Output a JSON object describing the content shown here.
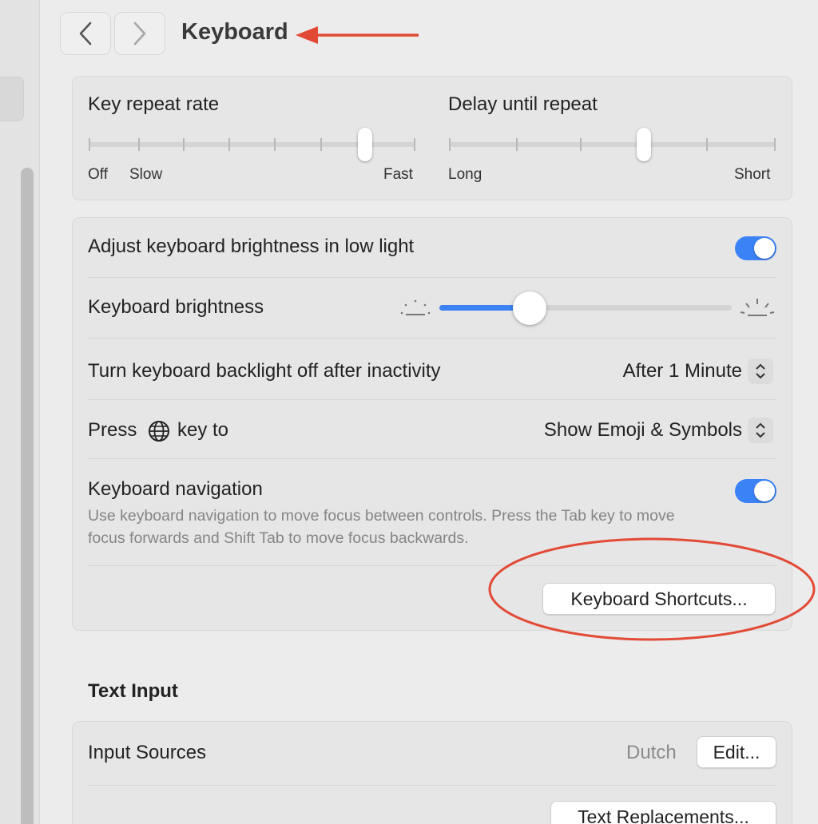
{
  "window": {
    "title": "Keyboard",
    "back_icon": "chevron-left-icon",
    "forward_icon": "chevron-right-icon",
    "accent": "#3b82f6",
    "annotation_color": "#e24a35"
  },
  "key_repeat": {
    "label": "Key repeat rate",
    "ticks": [
      "Off",
      "Slow",
      "Fast"
    ],
    "value_fraction": 0.85
  },
  "delay_repeat": {
    "label": "Delay until repeat",
    "ticks": [
      "Long",
      "Short"
    ],
    "value_fraction": 0.6
  },
  "brightness_group": {
    "adjust_label": "Adjust keyboard brightness in low light",
    "adjust_on": true,
    "brightness_label": "Keyboard brightness",
    "brightness_fraction": 0.31,
    "backlight_label": "Turn keyboard backlight off after inactivity",
    "backlight_value": "After 1 Minute",
    "globe_press": "Press",
    "globe_icon": "globe-icon",
    "globe_key_to": "key to",
    "globe_value": "Show Emoji & Symbols",
    "nav_label": "Keyboard navigation",
    "nav_on": true,
    "nav_description": "Use keyboard navigation to move focus between controls. Press the Tab key to move focus forwards and Shift Tab to move focus backwards.",
    "shortcuts_button": "Keyboard Shortcuts..."
  },
  "text_input": {
    "section_title": "Text Input",
    "input_sources_label": "Input Sources",
    "input_sources_value": "Dutch",
    "edit_button": "Edit...",
    "text_replacements_button": "Text Replacements..."
  }
}
